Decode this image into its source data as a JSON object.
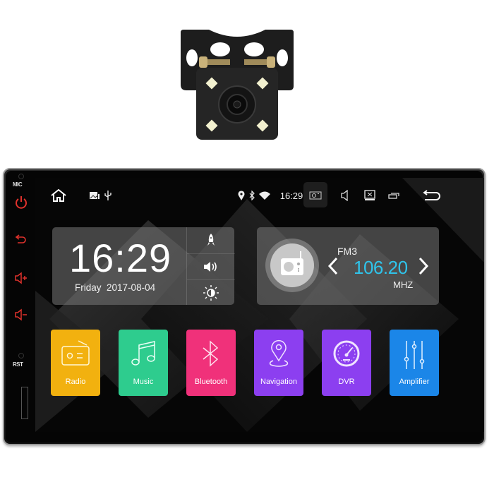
{
  "product": {
    "camera_name": "rear-view-camera",
    "camera_leds": 4
  },
  "side_panel": {
    "mic_label": "MIC",
    "rst_label": "RST",
    "buttons": [
      "power",
      "back",
      "volume-up",
      "volume-down"
    ],
    "button_color": "#e0322c"
  },
  "status_bar": {
    "time": "16:29",
    "left_icons": [
      "home-icon",
      "gallery-notification-icon",
      "usb-icon"
    ],
    "right_icons": [
      "location-icon",
      "bluetooth-icon",
      "wifi-icon"
    ],
    "nav_icons": [
      "screenshot-icon",
      "volume-icon",
      "close-app-icon",
      "recent-apps-icon",
      "back-icon"
    ]
  },
  "clock_widget": {
    "time": "16:29",
    "day": "Friday",
    "date": "2017-08-04",
    "quick_settings": [
      "rocket-icon",
      "volume-icon",
      "brightness-icon"
    ]
  },
  "radio_widget": {
    "band": "FM3",
    "frequency": "106.20",
    "unit": "MHZ",
    "frequency_color": "#2fc3ea"
  },
  "apps": [
    {
      "label": "Radio",
      "color": "#f2b10f",
      "icon": "radio-icon"
    },
    {
      "label": "Music",
      "color": "#2ecc8e",
      "icon": "music-note-icon"
    },
    {
      "label": "Bluetooth",
      "color": "#f0317a",
      "icon": "bluetooth-icon"
    },
    {
      "label": "Navigation",
      "color": "#8c3ff0",
      "icon": "map-pin-icon"
    },
    {
      "label": "DVR",
      "color": "#8c3ff0",
      "icon": "speedometer-icon"
    },
    {
      "label": "Amplifier",
      "color": "#1b86e8",
      "icon": "equalizer-icon"
    }
  ]
}
